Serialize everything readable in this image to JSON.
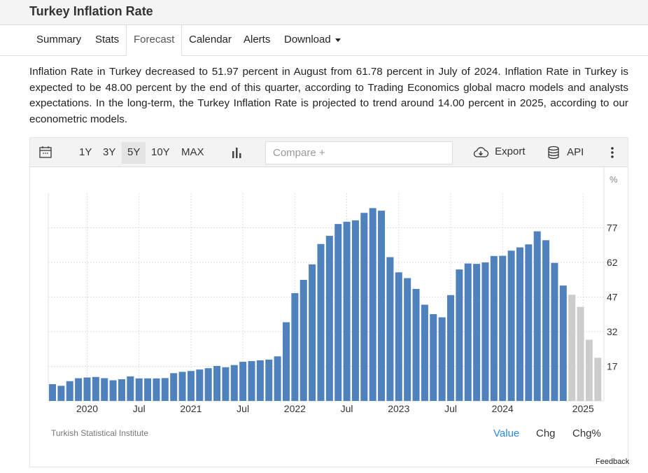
{
  "header": {
    "title": "Turkey Inflation Rate"
  },
  "tabs": [
    {
      "label": "Summary"
    },
    {
      "label": "Stats"
    },
    {
      "label": "Forecast"
    },
    {
      "label": "Calendar"
    },
    {
      "label": "Alerts"
    },
    {
      "label": "Download"
    }
  ],
  "description": "Inflation Rate in Turkey decreased to 51.97 percent in August from 61.78 percent in July of 2024. Inflation Rate in Turkey is expected to be 48.00 percent by the end of this quarter, according to Trading Economics global macro models and analysts expectations. In the long-term, the Turkey Inflation Rate is projected to trend around 14.00 percent in 2025, according to our econometric models.",
  "toolbar": {
    "ranges": [
      "1Y",
      "3Y",
      "5Y",
      "10Y",
      "MAX"
    ],
    "selected_range": "5Y",
    "compare_placeholder": "Compare +",
    "export_label": "Export",
    "api_label": "API"
  },
  "footer": {
    "source": "Turkish Statistical Institute",
    "modes": [
      "Value",
      "Chg",
      "Chg%"
    ],
    "active_mode": "Value",
    "feedback": "Feedback"
  },
  "colors": {
    "actual": "#4f81bd",
    "forecast": "#cccccc",
    "active_mode": "#2a8ad8"
  },
  "chart_data": {
    "type": "bar",
    "unit": "%",
    "categories": [
      "2019-09",
      "2019-10",
      "2019-11",
      "2019-12",
      "2020-01",
      "2020-02",
      "2020-03",
      "2020-04",
      "2020-05",
      "2020-06",
      "2020-07",
      "2020-08",
      "2020-09",
      "2020-10",
      "2020-11",
      "2020-12",
      "2021-01",
      "2021-02",
      "2021-03",
      "2021-04",
      "2021-05",
      "2021-06",
      "2021-07",
      "2021-08",
      "2021-09",
      "2021-10",
      "2021-11",
      "2021-12",
      "2022-01",
      "2022-02",
      "2022-03",
      "2022-04",
      "2022-05",
      "2022-06",
      "2022-07",
      "2022-08",
      "2022-09",
      "2022-10",
      "2022-11",
      "2022-12",
      "2023-01",
      "2023-02",
      "2023-03",
      "2023-04",
      "2023-05",
      "2023-06",
      "2023-07",
      "2023-08",
      "2023-09",
      "2023-10",
      "2023-11",
      "2023-12",
      "2024-01",
      "2024-02",
      "2024-03",
      "2024-04",
      "2024-05",
      "2024-06",
      "2024-07",
      "2024-08",
      "2024-09",
      "2024-10",
      "2024-11",
      "2024-12"
    ],
    "series": [
      {
        "name": "Actual",
        "values": [
          9.26,
          8.55,
          10.56,
          11.84,
          12.15,
          12.37,
          11.86,
          10.94,
          11.39,
          12.62,
          11.76,
          11.77,
          11.75,
          11.89,
          14.03,
          14.6,
          14.97,
          15.61,
          16.19,
          17.14,
          16.59,
          17.53,
          18.95,
          19.25,
          19.58,
          19.89,
          21.31,
          36.08,
          48.69,
          54.44,
          61.14,
          69.97,
          73.5,
          78.62,
          79.6,
          80.21,
          83.45,
          85.51,
          84.39,
          64.27,
          57.68,
          55.18,
          50.51,
          43.68,
          39.59,
          38.21,
          47.83,
          58.94,
          61.53,
          61.36,
          61.98,
          64.77,
          64.86,
          67.07,
          68.5,
          69.8,
          75.45,
          71.6,
          61.78,
          51.97,
          null,
          null,
          null,
          null
        ]
      },
      {
        "name": "Forecast",
        "values": [
          null,
          null,
          null,
          null,
          null,
          null,
          null,
          null,
          null,
          null,
          null,
          null,
          null,
          null,
          null,
          null,
          null,
          null,
          null,
          null,
          null,
          null,
          null,
          null,
          null,
          null,
          null,
          null,
          null,
          null,
          null,
          null,
          null,
          null,
          null,
          null,
          null,
          null,
          null,
          null,
          null,
          null,
          null,
          null,
          null,
          null,
          null,
          null,
          null,
          null,
          null,
          null,
          null,
          null,
          null,
          null,
          null,
          null,
          null,
          null,
          48.0,
          42.7,
          28.5,
          20.7
        ]
      }
    ],
    "x_ticks": [
      {
        "label": "2020",
        "at": 4
      },
      {
        "label": "Jul",
        "at": 10
      },
      {
        "label": "2021",
        "at": 16
      },
      {
        "label": "Jul",
        "at": 22
      },
      {
        "label": "2022",
        "at": 28
      },
      {
        "label": "Jul",
        "at": 34
      },
      {
        "label": "2023",
        "at": 40
      },
      {
        "label": "Jul",
        "at": 46
      },
      {
        "label": "2024",
        "at": 52
      },
      {
        "label": "2025",
        "at": 61.3
      }
    ],
    "y_ticks": [
      17,
      32,
      47,
      62,
      77
    ],
    "ylim": [
      2,
      92
    ],
    "grid": true,
    "axis_side": "right"
  }
}
